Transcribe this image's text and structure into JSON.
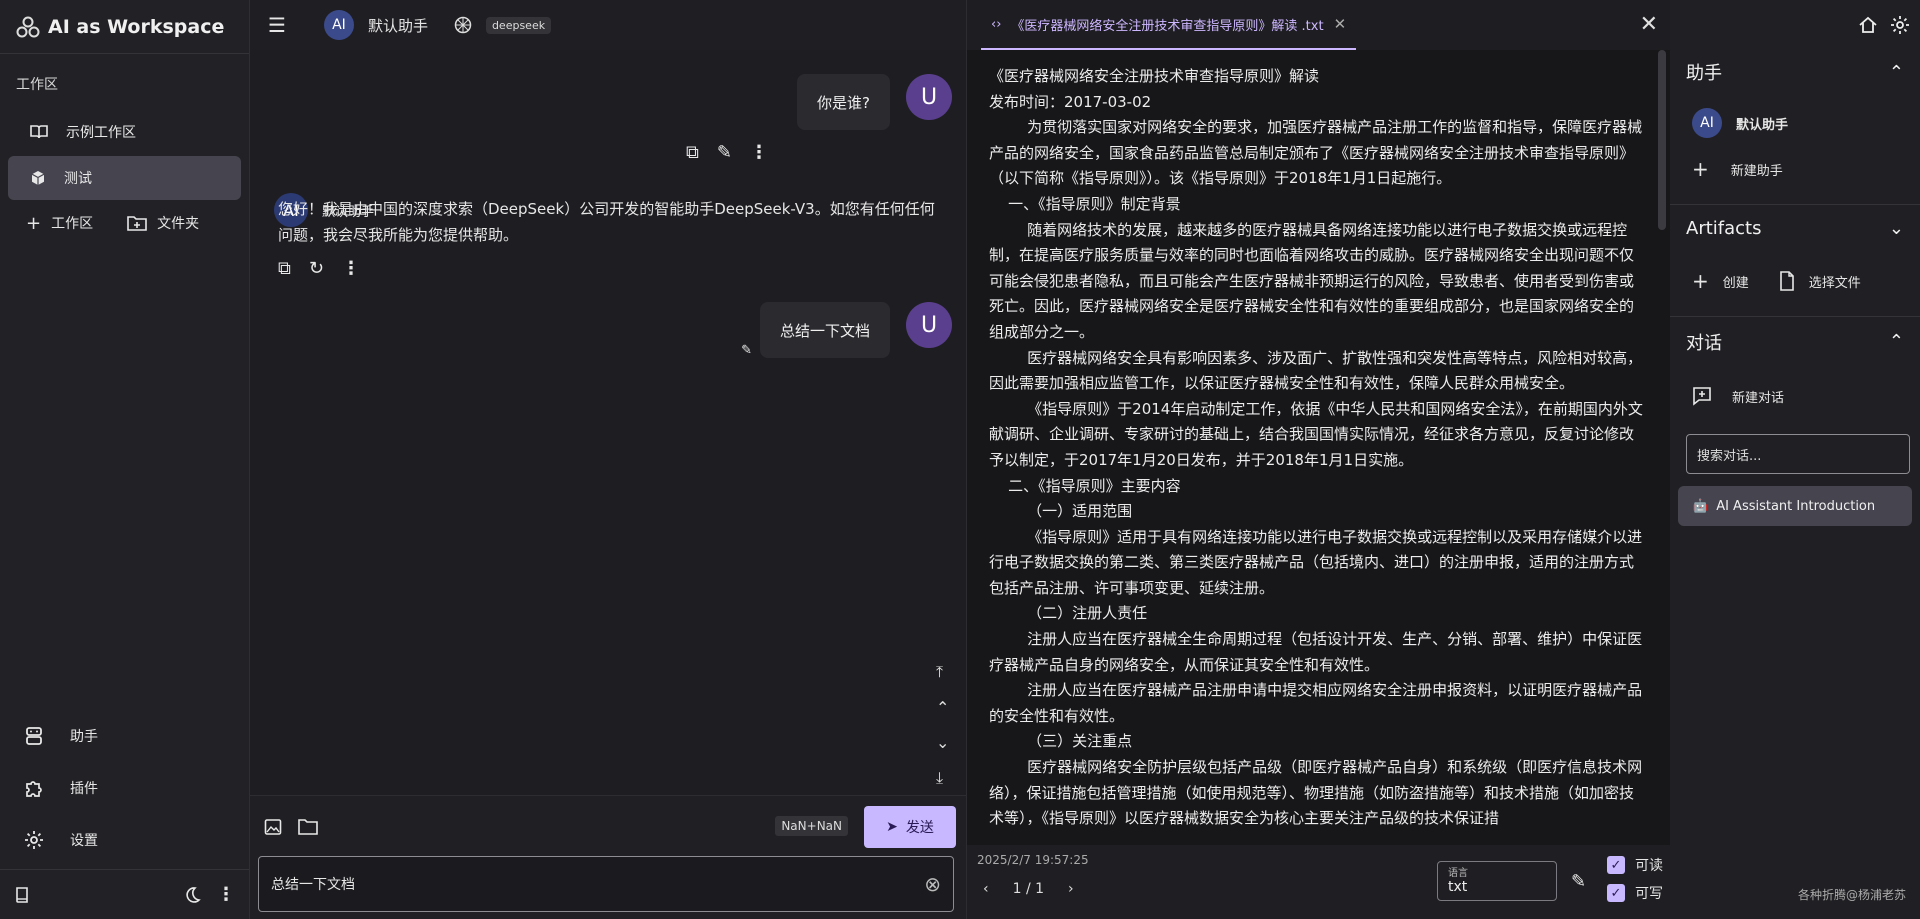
{
  "left": {
    "brand": "AI as Workspace",
    "workspace_title": "工作区",
    "items": [
      {
        "label": "示例工作区"
      },
      {
        "label": "测试"
      }
    ],
    "add_workspace": "工作区",
    "add_folder": "文件夹",
    "bottom": [
      {
        "label": "助手"
      },
      {
        "label": "插件"
      },
      {
        "label": "设置"
      }
    ]
  },
  "chat": {
    "assistant_name": "默认助手",
    "avatar_ai": "AI",
    "model": "deepseek",
    "user_avatar": "U",
    "user_msg_1": "你是谁?",
    "ai_name": "默认助手",
    "ai_reply": "您好！我是由中国的深度求索（DeepSeek）公司开发的智能助手DeepSeek-V3。如您有任何任何问题，我会尽我所能为您提供帮助。",
    "user_msg_2": "总结一下文档",
    "nan_badge": "NaN+NaN",
    "send_label": "发送",
    "input_value": "总结一下文档"
  },
  "doc": {
    "tab_title": "《医疗器械网络安全注册技术审查指导原则》解读 .txt",
    "content": "《医疗器械网络安全注册技术审查指导原则》解读\n发布时间：2017-03-02\n        为贯彻落实国家对网络安全的要求，加强医疗器械产品注册工作的监督和指导，保障医疗器械产品的网络安全，国家食品药品监管总局制定颁布了《医疗器械网络安全注册技术审查指导原则》（以下简称《指导原则》）。该《指导原则》于2018年1月1日起施行。\n    一、《指导原则》制定背景\n        随着网络技术的发展，越来越多的医疗器械具备网络连接功能以进行电子数据交换或远程控制，在提高医疗服务质量与效率的同时也面临着网络攻击的威胁。医疗器械网络安全出现问题不仅可能会侵犯患者隐私，而且可能会产生医疗器械非预期运行的风险，导致患者、使用者受到伤害或死亡。因此，医疗器械网络安全是医疗器械安全性和有效性的重要组成部分，也是国家网络安全的组成部分之一。\n        医疗器械网络安全具有影响因素多、涉及面广、扩散性强和突发性高等特点，风险相对较高，因此需要加强相应监管工作，以保证医疗器械安全性和有效性，保障人民群众用械安全。\n        《指导原则》于2014年启动制定工作，依据《中华人民共和国网络安全法》，在前期国内外文献调研、企业调研、专家研讨的基础上，结合我国国情实际情况，经征求各方意见，反复讨论修改予以制定，于2017年1月20日发布，并于2018年1月1日实施。\n    二、《指导原则》主要内容\n        （一）适用范围\n        《指导原则》适用于具有网络连接功能以进行电子数据交换或远程控制以及采用存储媒介以进行电子数据交换的第二类、第三类医疗器械产品（包括境内、进口）的注册申报，适用的注册方式包括产品注册、许可事项变更、延续注册。\n        （二）注册人责任\n        注册人应当在医疗器械全生命周期过程（包括设计开发、生产、分销、部署、维护）中保证医疗器械产品自身的网络安全，从而保证其安全性和有效性。\n        注册人应当在医疗器械产品注册申请中提交相应网络安全注册申报资料，以证明医疗器械产品的安全性和有效性。\n        （三）关注重点\n        医疗器械网络安全防护层级包括产品级（即医疗器械产品自身）和系统级（即医疗信息技术网络），保证措施包括管理措施（如使用规范等）、物理措施（如防盗措施等）和技术措施（如加密技术等），《指导原则》以医疗器械数据安全为核心主要关注产品级的技术保证措",
    "timestamp": "2025/2/7 19:57:25",
    "page": "1 / 1",
    "lang_label": "语言",
    "lang_value": "txt",
    "readable": "可读",
    "writable": "可写"
  },
  "right": {
    "assistant_section": "助手",
    "assistant_item": "默认助手",
    "assistant_avatar": "AI",
    "new_assistant": "新建助手",
    "artifacts_section": "Artifacts",
    "create": "创建",
    "choose_file": "选择文件",
    "conversation_section": "对话",
    "new_conversation": "新建对话",
    "search_placeholder": "搜索对话...",
    "conversation_item": "AI Assistant Introduction",
    "watermark": "各种折腾@杨浦老苏"
  },
  "colors": {
    "accent": "#c8b8ff",
    "tab_active": "#cdb7ff",
    "active_bg": "#46444f"
  }
}
